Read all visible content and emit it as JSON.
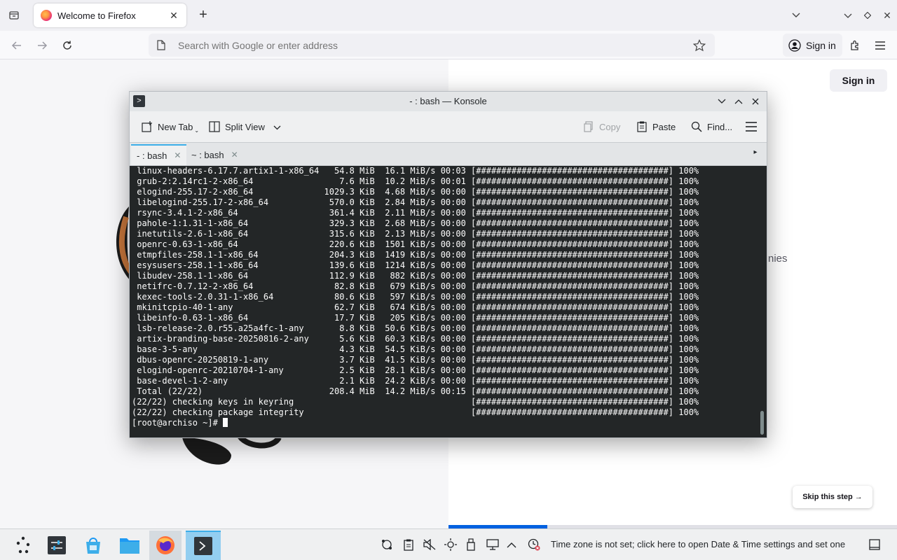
{
  "firefox": {
    "tab_title": "Welcome to Firefox",
    "address_placeholder": "Search with Google or enter address",
    "sign_in_label": "Sign in"
  },
  "page": {
    "sign_in_label": "Sign in",
    "obscured_text": "nies",
    "skip_label": "Skip this step →",
    "progress_fraction": 0.22
  },
  "konsole": {
    "window_title": "- : bash — Konsole",
    "toolbar": {
      "new_tab": "New Tab",
      "split_view": "Split View",
      "copy": "Copy",
      "paste": "Paste",
      "find": "Find..."
    },
    "tabs": [
      {
        "label": "- : bash"
      },
      {
        "label": "~ : bash"
      }
    ],
    "terminal_lines": [
      " linux-headers-6.17.7.artix1-1-x86_64   54.8 MiB  16.1 MiB/s 00:03 [######################################] 100%",
      " grub-2:2.14rc1-2-x86_64                 7.6 MiB  10.2 MiB/s 00:01 [######################################] 100%",
      " elogind-255.17-2-x86_64              1029.3 KiB  4.68 MiB/s 00:00 [######################################] 100%",
      " libelogind-255.17-2-x86_64            570.0 KiB  2.84 MiB/s 00:00 [######################################] 100%",
      " rsync-3.4.1-2-x86_64                  361.4 KiB  2.11 MiB/s 00:00 [######################################] 100%",
      " pahole-1:1.31-1-x86_64                329.3 KiB  2.68 MiB/s 00:00 [######################################] 100%",
      " inetutils-2.6-1-x86_64                315.6 KiB  2.13 MiB/s 00:00 [######################################] 100%",
      " openrc-0.63-1-x86_64                  220.6 KiB  1501 KiB/s 00:00 [######################################] 100%",
      " etmpfiles-258.1-1-x86_64              204.3 KiB  1419 KiB/s 00:00 [######################################] 100%",
      " esysusers-258.1-1-x86_64              139.6 KiB  1214 KiB/s 00:00 [######################################] 100%",
      " libudev-258.1-1-x86_64                112.9 KiB   882 KiB/s 00:00 [######################################] 100%",
      " netifrc-0.7.12-2-x86_64                82.8 KiB   679 KiB/s 00:00 [######################################] 100%",
      " kexec-tools-2.0.31-1-x86_64            80.6 KiB   597 KiB/s 00:00 [######################################] 100%",
      " mkinitcpio-40-1-any                    62.7 KiB   674 KiB/s 00:00 [######################################] 100%",
      " libeinfo-0.63-1-x86_64                 17.7 KiB   205 KiB/s 00:00 [######################################] 100%",
      " lsb-release-2.0.r55.a25a4fc-1-any       8.8 KiB  50.6 KiB/s 00:00 [######################################] 100%",
      " artix-branding-base-20250816-2-any      5.6 KiB  60.3 KiB/s 00:00 [######################################] 100%",
      " base-3-5-any                            4.3 KiB  54.5 KiB/s 00:00 [######################################] 100%",
      " dbus-openrc-20250819-1-any              3.7 KiB  41.5 KiB/s 00:00 [######################################] 100%",
      " elogind-openrc-20210704-1-any           2.5 KiB  28.1 KiB/s 00:00 [######################################] 100%",
      " base-devel-1-2-any                      2.1 KiB  24.2 KiB/s 00:00 [######################################] 100%",
      " Total (22/22)                         208.4 MiB  14.2 MiB/s 00:15 [######################################] 100%",
      "(22/22) checking keys in keyring                                   [######################################] 100%",
      "(22/22) checking package integrity                                 [######################################] 100%"
    ],
    "prompt": "[root@archiso ~]# "
  },
  "taskbar": {
    "timezone_message": "Time zone is not set; click here to open Date & Time settings and set one"
  },
  "colors": {
    "terminal_bg": "#232627",
    "terminal_fg": "#fcfcfc",
    "accent": "#3daee9",
    "firefox_progress": "#0061e0"
  }
}
